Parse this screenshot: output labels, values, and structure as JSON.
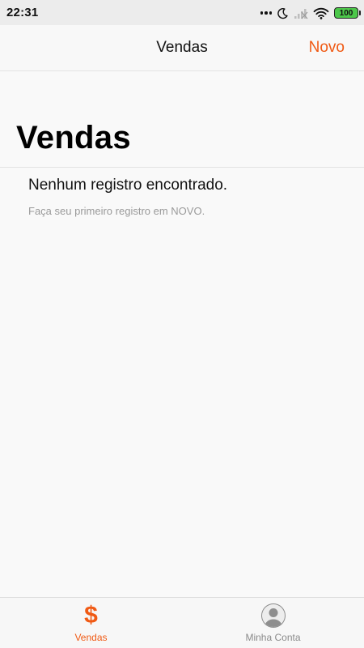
{
  "status_bar": {
    "time": "22:31",
    "battery": "100",
    "icons": [
      "more-dots-icon",
      "moon-icon",
      "signal-icon",
      "wifi-icon",
      "battery-icon"
    ]
  },
  "nav_bar": {
    "title": "Vendas",
    "new_button": "Novo"
  },
  "main": {
    "large_title": "Vendas",
    "empty_title": "Nenhum registro encontrado.",
    "empty_subtitle": "Faça seu primeiro registro em NOVO."
  },
  "tab_bar": {
    "tabs": [
      {
        "label": "Vendas",
        "icon": "dollar-icon",
        "active": true
      },
      {
        "label": "Minha Conta",
        "icon": "user-avatar-icon",
        "active": false
      }
    ]
  },
  "colors": {
    "accent": "#f05a14",
    "background": "#f9f9f9",
    "status_bar": "#ececec",
    "battery": "#4cc74a",
    "inactive_tab": "#8a8a8a"
  }
}
